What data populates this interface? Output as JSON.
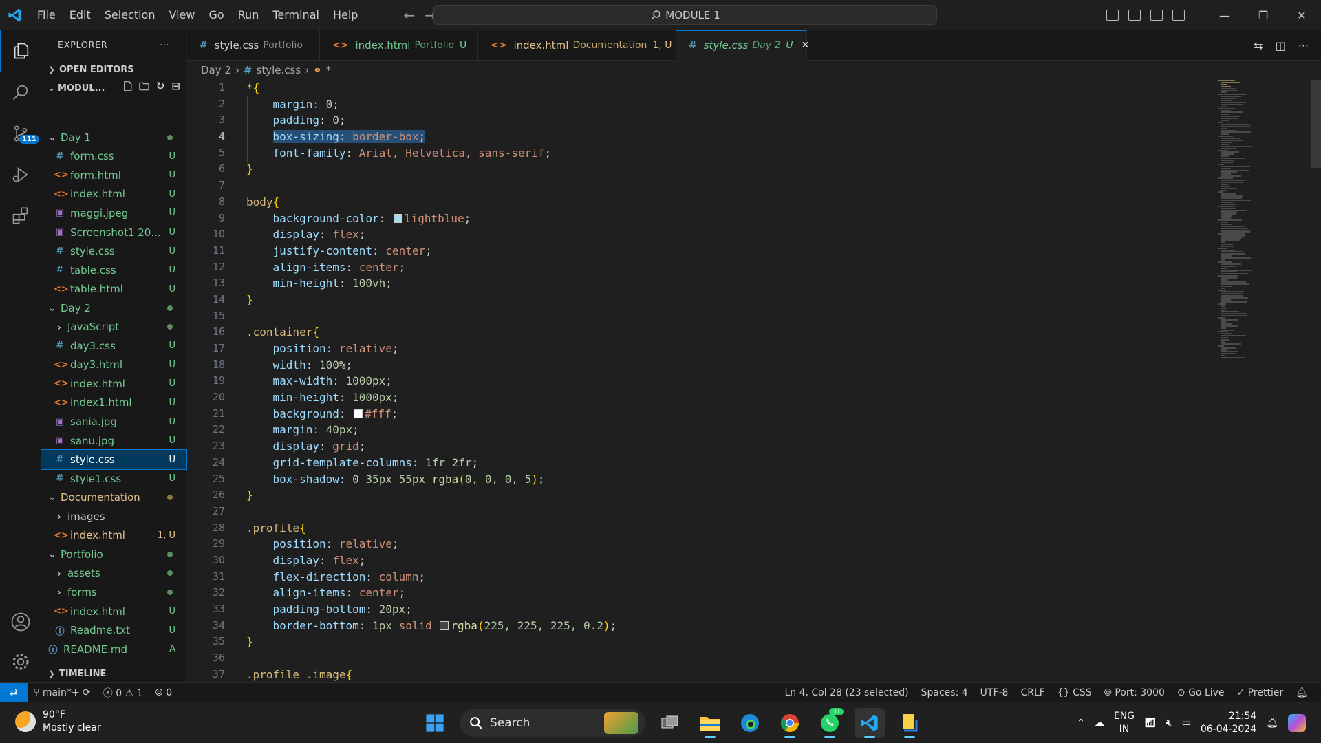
{
  "menu": [
    "File",
    "Edit",
    "Selection",
    "View",
    "Go",
    "Run",
    "Terminal",
    "Help"
  ],
  "command_center": "MODULE 1",
  "explorer": {
    "title": "EXPLORER",
    "open_editors": "OPEN EDITORS",
    "workspace": "MODUL...",
    "timeline": "TIMELINE",
    "tree": [
      {
        "name": "Day 1",
        "kind": "folder",
        "open": true,
        "level": 1,
        "status": "dot"
      },
      {
        "name": "form.css",
        "kind": "css",
        "level": 2,
        "status": "U"
      },
      {
        "name": "form.html",
        "kind": "html",
        "level": 2,
        "status": "U"
      },
      {
        "name": "index.html",
        "kind": "html",
        "level": 2,
        "status": "U"
      },
      {
        "name": "maggi.jpeg",
        "kind": "img",
        "level": 2,
        "status": "U"
      },
      {
        "name": "Screenshot1 20...",
        "kind": "img",
        "level": 2,
        "status": "U"
      },
      {
        "name": "style.css",
        "kind": "css",
        "level": 2,
        "status": "U"
      },
      {
        "name": "table.css",
        "kind": "css",
        "level": 2,
        "status": "U"
      },
      {
        "name": "table.html",
        "kind": "html",
        "level": 2,
        "status": "U"
      },
      {
        "name": "Day 2",
        "kind": "folder",
        "open": true,
        "level": 1,
        "status": "dot"
      },
      {
        "name": "JavaScript",
        "kind": "folder",
        "open": false,
        "level": 2,
        "status": "dot"
      },
      {
        "name": "day3.css",
        "kind": "css",
        "level": 2,
        "status": "U"
      },
      {
        "name": "day3.html",
        "kind": "html",
        "level": 2,
        "status": "U"
      },
      {
        "name": "index.html",
        "kind": "html",
        "level": 2,
        "status": "U"
      },
      {
        "name": "index1.html",
        "kind": "html",
        "level": 2,
        "status": "U"
      },
      {
        "name": "sania.jpg",
        "kind": "img",
        "level": 2,
        "status": "U"
      },
      {
        "name": "sanu.jpg",
        "kind": "img",
        "level": 2,
        "status": "U"
      },
      {
        "name": "style.css",
        "kind": "css",
        "level": 2,
        "status": "U",
        "selected": true
      },
      {
        "name": "style1.css",
        "kind": "css",
        "level": 2,
        "status": "U"
      },
      {
        "name": "Documentation",
        "kind": "folder",
        "open": true,
        "level": 1,
        "status": "doty"
      },
      {
        "name": "images",
        "kind": "folder",
        "open": false,
        "level": 2,
        "status": ""
      },
      {
        "name": "index.html",
        "kind": "html",
        "level": 2,
        "status": "1, U",
        "warn": true
      },
      {
        "name": "Portfolio",
        "kind": "folder",
        "open": true,
        "level": 1,
        "status": "dot"
      },
      {
        "name": "assets",
        "kind": "folder",
        "open": false,
        "level": 2,
        "status": "dot"
      },
      {
        "name": "forms",
        "kind": "folder",
        "open": false,
        "level": 2,
        "status": "dot"
      },
      {
        "name": "index.html",
        "kind": "html",
        "level": 2,
        "status": "U"
      },
      {
        "name": "Readme.txt",
        "kind": "info",
        "level": 2,
        "status": "U"
      },
      {
        "name": "README.md",
        "kind": "info",
        "level": 1,
        "status": "A"
      }
    ]
  },
  "tabs": [
    {
      "name": "style.css",
      "desc": "Portfolio",
      "kind": "css",
      "status": ""
    },
    {
      "name": "index.html",
      "desc": "Portfolio",
      "kind": "html",
      "status": "U"
    },
    {
      "name": "index.html",
      "desc": "Documentation",
      "kind": "html",
      "status": "1, U",
      "warn": true
    },
    {
      "name": "style.css",
      "desc": "Day 2",
      "kind": "css",
      "status": "U",
      "active": true
    }
  ],
  "breadcrumb": [
    "Day 2",
    "style.css",
    "*"
  ],
  "code_lines": [
    "*{",
    "    margin: 0;",
    "    padding: 0;",
    "    box-sizing: border-box;",
    "    font-family: Arial, Helvetica, sans-serif;",
    "}",
    "",
    "body{",
    "    background-color: lightblue;",
    "    display: flex;",
    "    justify-content: center;",
    "    align-items: center;",
    "    min-height: 100vh;",
    "}",
    "",
    ".container{",
    "    position: relative;",
    "    width: 100%;",
    "    max-width: 1000px;",
    "    min-height: 1000px;",
    "    background: #fff;",
    "    margin: 40px;",
    "    display: grid;",
    "    grid-template-columns: 1fr 2fr;",
    "    box-shadow: 0 35px 55px rgba(0, 0, 0, 5);",
    "}",
    "",
    ".profile{",
    "    position: relative;",
    "    display: flex;",
    "    flex-direction: column;",
    "    align-items: center;",
    "    padding-bottom: 20px;",
    "    border-bottom: 1px solid rgba(225, 225, 225, 0.2);",
    "}",
    "",
    ".profile .image{"
  ],
  "line_numbers": [
    "1",
    "2",
    "3",
    "4",
    "5",
    "6",
    "7",
    "8",
    "9",
    "10",
    "11",
    "12",
    "13",
    "14",
    "15",
    "16",
    "17",
    "18",
    "19",
    "20",
    "21",
    "22",
    "23",
    "24",
    "25",
    "26",
    "27",
    "28",
    "29",
    "30",
    "31",
    "32",
    "33",
    "34",
    "35",
    "36",
    "37"
  ],
  "status_bar": {
    "branch": "main*+",
    "errors": "0",
    "warnings": "1",
    "ports": "0",
    "cursor": "Ln 4, Col 28 (23 selected)",
    "spaces": "Spaces: 4",
    "encoding": "UTF-8",
    "eol": "CRLF",
    "language": "CSS",
    "port": "Port: 3000",
    "golive": "Go Live",
    "prettier": "Prettier"
  },
  "source_control_badge": "111",
  "taskbar": {
    "temp": "90°F",
    "weather": "Mostly clear",
    "search": "Search",
    "whatsapp_badge": "31",
    "lang1": "ENG",
    "lang2": "IN",
    "time": "21:54",
    "date": "06-04-2024"
  },
  "colors": {
    "accent": "#0078d4",
    "editor_bg": "#1f1f1f",
    "sidebar_bg": "#181818"
  }
}
